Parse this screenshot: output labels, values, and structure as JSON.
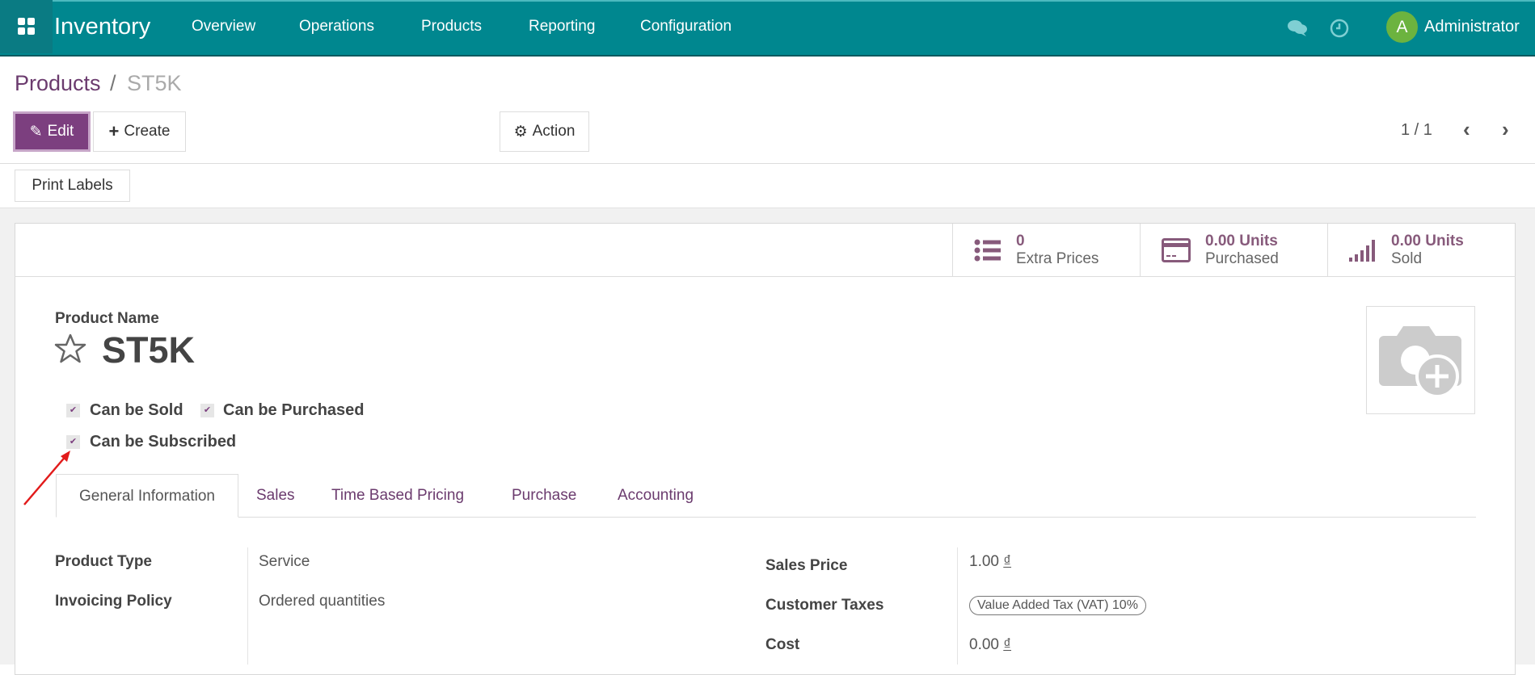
{
  "navbar": {
    "app": "Inventory",
    "menu": [
      "Overview",
      "Operations",
      "Products",
      "Reporting",
      "Configuration"
    ],
    "avatar_letter": "A",
    "user": "Administrator"
  },
  "breadcrumb": {
    "parent": "Products",
    "sep": "/",
    "current": "ST5K"
  },
  "toolbar": {
    "edit": "Edit",
    "create": "Create",
    "action": "Action",
    "pager": "1 / 1",
    "print_labels": "Print Labels"
  },
  "stats": [
    {
      "value": "0",
      "label": "Extra Prices"
    },
    {
      "value": "0.00 Units",
      "label": "Purchased"
    },
    {
      "value": "0.00 Units",
      "label": "Sold"
    }
  ],
  "product": {
    "name_label": "Product Name",
    "name": "ST5K",
    "checkboxes": [
      "Can be Sold",
      "Can be Purchased",
      "Can be Subscribed"
    ]
  },
  "tabs": [
    "General Information",
    "Sales",
    "Time Based Pricing",
    "Purchase",
    "Accounting"
  ],
  "fields_left": [
    {
      "label": "Product Type",
      "value": "Service"
    },
    {
      "label": "Invoicing Policy",
      "value": "Ordered quantities"
    }
  ],
  "fields_right": [
    {
      "label": "Sales Price",
      "value": "1.00",
      "currency": "₫"
    },
    {
      "label": "Customer Taxes",
      "value": "Value Added Tax (VAT) 10%"
    },
    {
      "label": "Cost",
      "value": "0.00",
      "currency": "₫"
    }
  ],
  "colors": {
    "navbar": "#00878f",
    "primary": "#7c3f7f",
    "accent": "#875a7b"
  }
}
